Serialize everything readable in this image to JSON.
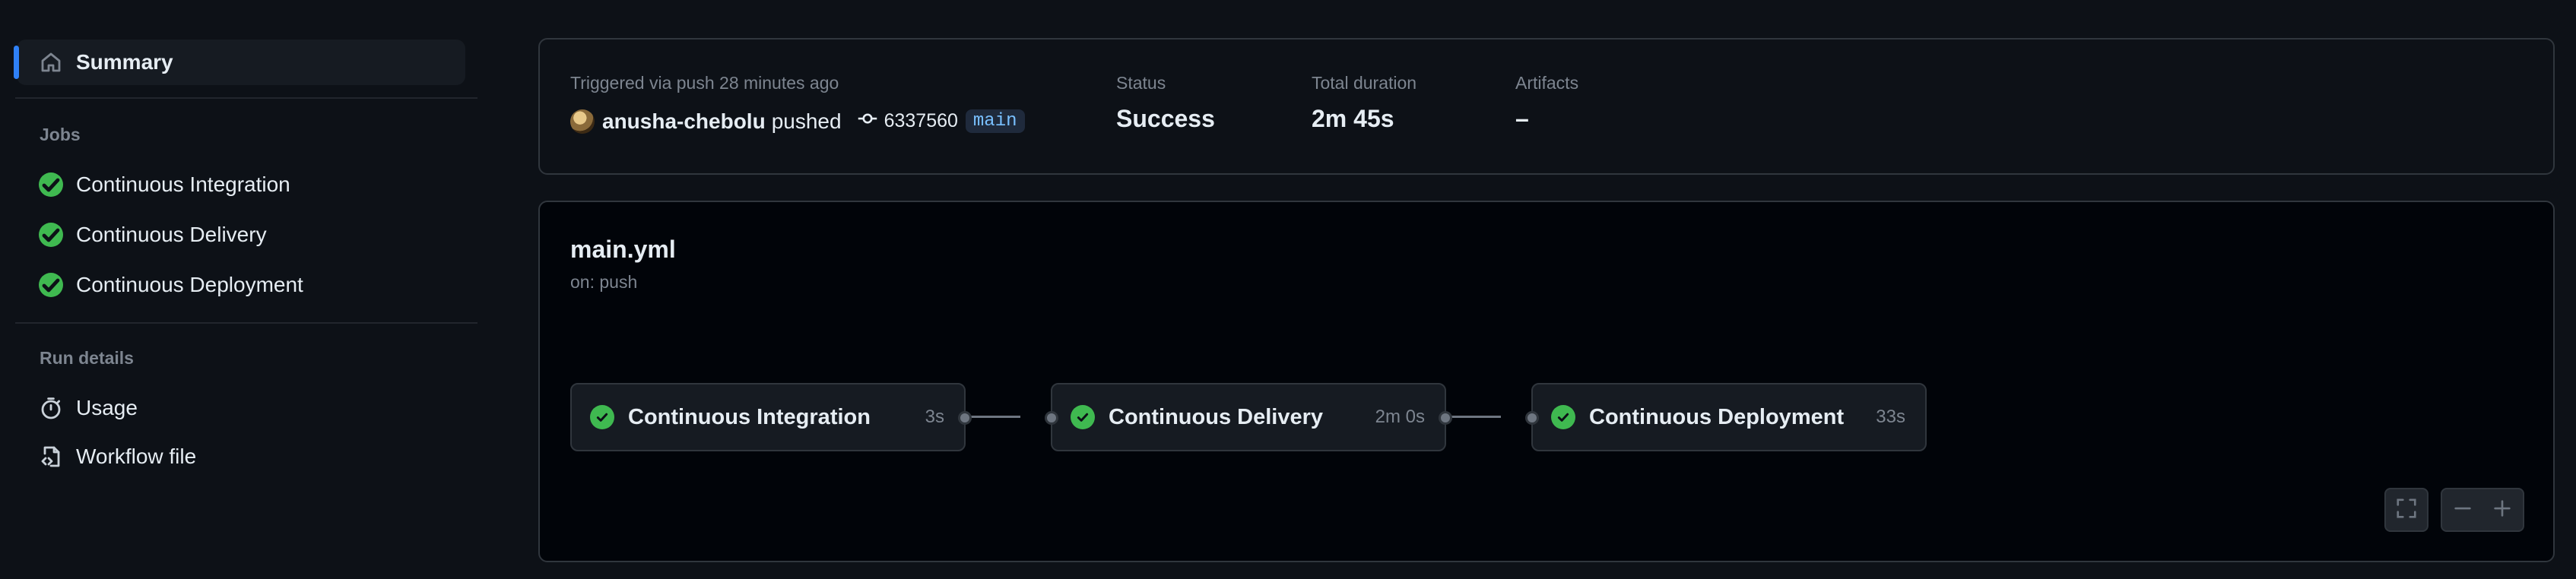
{
  "sidebar": {
    "summary_label": "Summary",
    "jobs_heading": "Jobs",
    "jobs": [
      {
        "label": "Continuous Integration",
        "status": "success"
      },
      {
        "label": "Continuous Delivery",
        "status": "success"
      },
      {
        "label": "Continuous Deployment",
        "status": "success"
      }
    ],
    "run_details_heading": "Run details",
    "usage_label": "Usage",
    "workflow_file_label": "Workflow file"
  },
  "summary": {
    "trigger_text": "Triggered via push 28 minutes ago",
    "actor": "anusha-chebolu",
    "action": "pushed",
    "commit": "6337560",
    "branch": "main",
    "status_label": "Status",
    "status_value": "Success",
    "duration_label": "Total duration",
    "duration_value": "2m 45s",
    "artifacts_label": "Artifacts",
    "artifacts_value": "–"
  },
  "workflow": {
    "file": "main.yml",
    "trigger": "on: push",
    "jobs": [
      {
        "name": "Continuous Integration",
        "duration": "3s"
      },
      {
        "name": "Continuous Delivery",
        "duration": "2m 0s"
      },
      {
        "name": "Continuous Deployment",
        "duration": "33s"
      }
    ]
  },
  "colors": {
    "background": "#0d1117",
    "success": "#3fb950",
    "accent": "#2f81f7",
    "border": "#30363d",
    "muted_text": "#7d8590"
  },
  "icons": {
    "summary": "home-icon",
    "job_status": "check-circle-icon",
    "usage": "stopwatch-icon",
    "workflow_file": "file-code-icon",
    "commit": "git-commit-icon",
    "fullscreen": "fullscreen-icon",
    "zoom_out": "minus-icon",
    "zoom_in": "plus-icon"
  }
}
